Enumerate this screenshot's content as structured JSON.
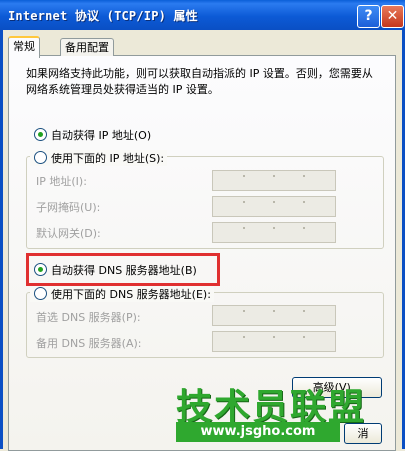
{
  "window": {
    "title": "Internet 协议 (TCP/IP) 属性",
    "help_label": "?",
    "close_label": "✕"
  },
  "tabs": [
    {
      "label": "常规",
      "active": true
    },
    {
      "label": "备用配置",
      "active": false
    }
  ],
  "description": "如果网络支持此功能，则可以获取自动指派的 IP 设置。否则，您需要从网络系统管理员处获得适当的 IP 设置。",
  "ip": {
    "auto_label": "自动获得 IP 地址(O)",
    "manual_label": "使用下面的 IP 地址(S):",
    "selected": "auto",
    "fields": [
      {
        "label": "IP 地址(I):",
        "value": ". . ."
      },
      {
        "label": "子网掩码(U):",
        "value": ". . ."
      },
      {
        "label": "默认网关(D):",
        "value": ". . ."
      }
    ]
  },
  "dns": {
    "auto_label": "自动获得 DNS 服务器地址(B)",
    "manual_label": "使用下面的 DNS 服务器地址(E):",
    "selected": "auto",
    "fields": [
      {
        "label": "首选 DNS 服务器(P):",
        "value": ". . ."
      },
      {
        "label": "备用 DNS 服务器(A):",
        "value": ". . ."
      }
    ]
  },
  "buttons": {
    "advanced_label": "高级(V)...",
    "cancel_label": "消"
  },
  "watermark": {
    "title": "技术员联盟",
    "url": "www.jsgho.com"
  },
  "colors": {
    "titlebar": "#0a5fd8",
    "highlight": "#e03030",
    "watermark": "#2fa82f"
  }
}
